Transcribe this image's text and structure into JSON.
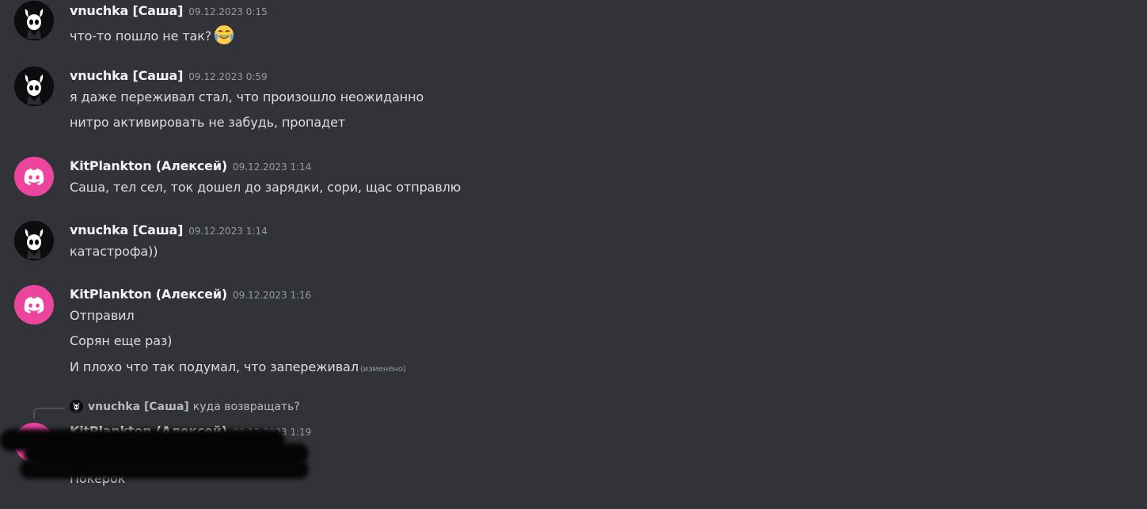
{
  "messages": [
    {
      "author": "vnuchka [Саша]",
      "timestamp": "09.12.2023 0:15",
      "avatar_icon": "hollow-knight-icon",
      "lines": [
        "что-то пошло не так?"
      ],
      "emoji": "joy-emoji"
    },
    {
      "author": "vnuchka [Саша]",
      "timestamp": "09.12.2023 0:59",
      "avatar_icon": "hollow-knight-icon",
      "lines": [
        "я даже переживал стал, что произошло неожиданно",
        "нитро активировать не забудь, пропадет"
      ]
    },
    {
      "author": "KitPlankton (Алексей)",
      "timestamp": "09.12.2023 1:14",
      "avatar_icon": "discord-logo-icon",
      "lines": [
        "Саша, тел сел, ток дошел до зарядки, сори, щас отправлю"
      ]
    },
    {
      "author": "vnuchka [Саша]",
      "timestamp": "09.12.2023 1:14",
      "avatar_icon": "hollow-knight-icon",
      "lines": [
        "катастрофа))"
      ]
    },
    {
      "author": "KitPlankton (Алексей)",
      "timestamp": "09.12.2023 1:16",
      "avatar_icon": "discord-logo-icon",
      "lines": [
        "Отправил",
        "Сорян еще раз)",
        "И плохо что так подумал, что запереживал"
      ],
      "edited_label": "(изменено)"
    },
    {
      "author": "KitPlankton (Алексей)",
      "timestamp": "09.12.2023 1:19",
      "avatar_icon": "discord-logo-icon",
      "lines": [
        "Покерок"
      ],
      "reply": {
        "author": "vnuchka [Саша]",
        "text": "куда возвращать?"
      }
    }
  ],
  "colors": {
    "background": "#313338",
    "username": "#f2f3f5",
    "text": "#dbdee1",
    "timestamp": "#949ba4",
    "discord_avatar": "#eb459e"
  }
}
